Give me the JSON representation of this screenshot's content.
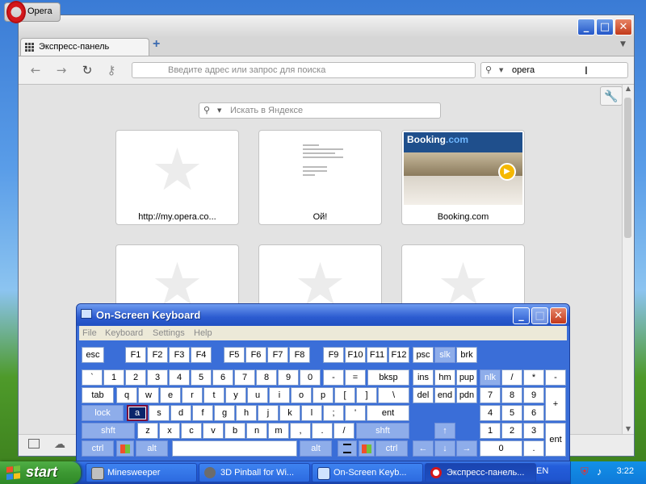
{
  "opera": {
    "menu_label": "Opera",
    "tab_title": "Экспресс-панель",
    "new_tab": "+",
    "address_placeholder": "Введите адрес или запрос для поиска",
    "search_value": "opera",
    "yandex_placeholder": "Искать в Яндексе",
    "window_buttons": {
      "minimize": "_",
      "maximize": "□",
      "close": "✕"
    },
    "tiles": [
      {
        "caption": "http://my.opera.co...",
        "thumb": "star"
      },
      {
        "caption": "Ой!",
        "thumb": "page"
      },
      {
        "caption": "Booking.com",
        "thumb": "booking",
        "brand": "Booking",
        "brand_suffix": ".com"
      },
      {
        "caption": "",
        "thumb": "star"
      },
      {
        "caption": "",
        "thumb": "star"
      },
      {
        "caption": "",
        "thumb": "star"
      }
    ]
  },
  "osk": {
    "title": "On-Screen Keyboard",
    "menu": [
      "File",
      "Keyboard",
      "Settings",
      "Help"
    ],
    "window_buttons": {
      "minimize": "_",
      "maximize": "□",
      "close": "✕"
    },
    "rows": {
      "r0": [
        "esc",
        "F1",
        "F2",
        "F3",
        "F4",
        "F5",
        "F6",
        "F7",
        "F8",
        "F9",
        "F10",
        "F11",
        "F12",
        "psc",
        "slk",
        "brk"
      ],
      "r1": [
        "`",
        "1",
        "2",
        "3",
        "4",
        "5",
        "6",
        "7",
        "8",
        "9",
        "0",
        "-",
        "=",
        "bksp",
        "ins",
        "hm",
        "pup",
        "nlk",
        "/",
        "*",
        "-"
      ],
      "r2": [
        "tab",
        "q",
        "w",
        "e",
        "r",
        "t",
        "y",
        "u",
        "i",
        "o",
        "p",
        "[",
        "]",
        "\\",
        "del",
        "end",
        "pdn",
        "7",
        "8",
        "9",
        "+"
      ],
      "r3": [
        "lock",
        "a",
        "s",
        "d",
        "f",
        "g",
        "h",
        "j",
        "k",
        "l",
        ";",
        "'",
        "ent",
        "4",
        "5",
        "6"
      ],
      "r4": [
        "shft",
        "z",
        "x",
        "c",
        "v",
        "b",
        "n",
        "m",
        ",",
        ".",
        "/",
        "shft",
        "↑",
        "1",
        "2",
        "3",
        "ent"
      ],
      "r5": [
        "ctrl",
        "alt",
        "alt",
        "ctrl",
        "←",
        "↓",
        "→",
        "0",
        "."
      ]
    }
  },
  "taskbar": {
    "start": "start",
    "tasks": [
      "Minesweeper",
      "3D Pinball for Wi...",
      "On-Screen Keyb...",
      "Экспресс-панель..."
    ],
    "lang": "EN",
    "clock": "3:22",
    "colors": {
      "start_green": "#3c9832",
      "taskbar_blue": "#245edb"
    }
  }
}
